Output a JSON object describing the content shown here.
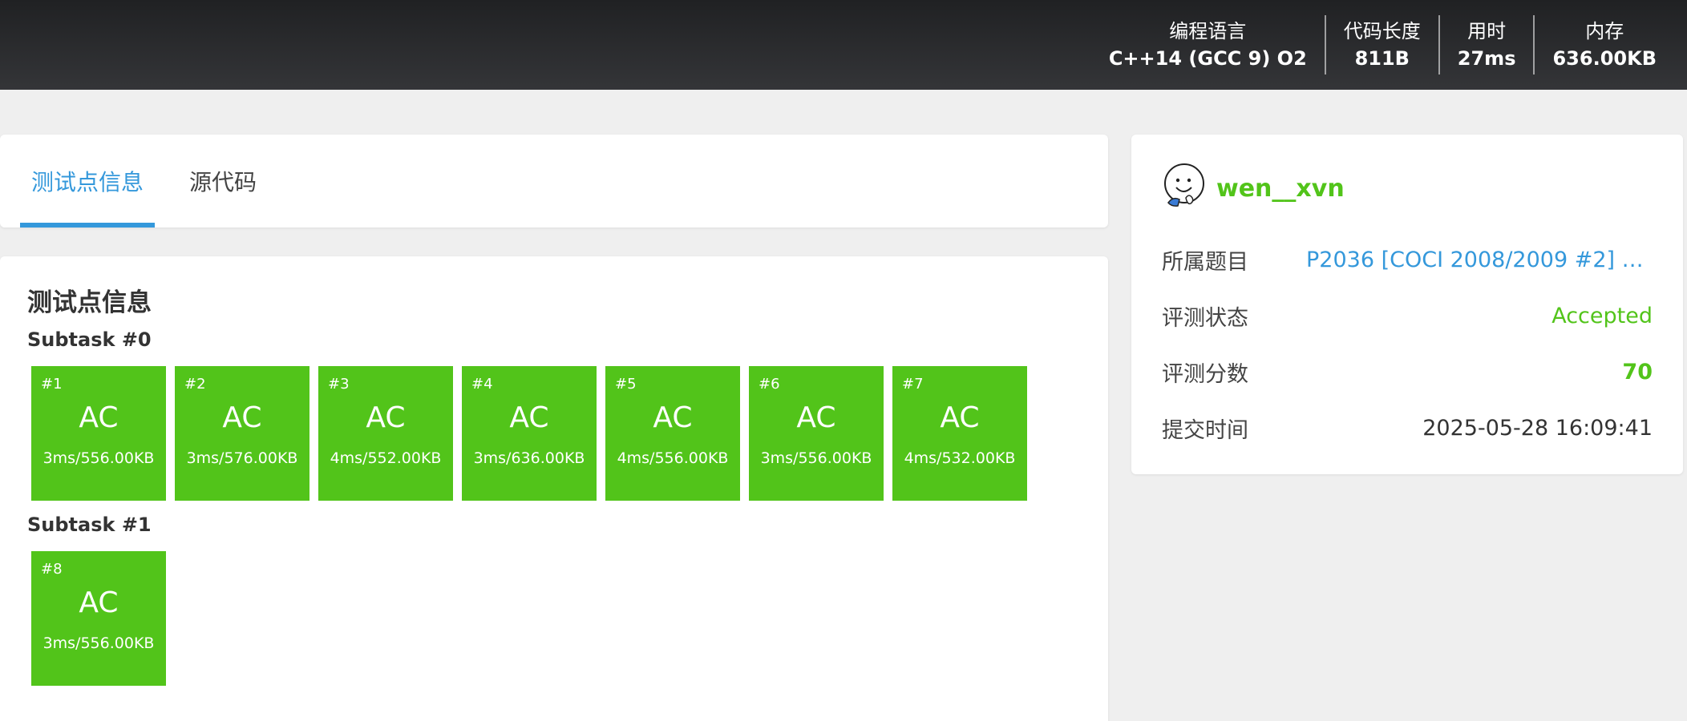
{
  "header": {
    "stats": [
      {
        "label": "编程语言",
        "value": "C++14 (GCC 9) O2"
      },
      {
        "label": "代码长度",
        "value": "811B"
      },
      {
        "label": "用时",
        "value": "27ms"
      },
      {
        "label": "内存",
        "value": "636.00KB"
      }
    ]
  },
  "tabs": {
    "testcase": "测试点信息",
    "source": "源代码"
  },
  "tests": {
    "title": "测试点信息",
    "subtasks": [
      {
        "title": "Subtask #0",
        "cases": [
          {
            "id": "#1",
            "status": "AC",
            "usage": "3ms/556.00KB"
          },
          {
            "id": "#2",
            "status": "AC",
            "usage": "3ms/576.00KB"
          },
          {
            "id": "#3",
            "status": "AC",
            "usage": "4ms/552.00KB"
          },
          {
            "id": "#4",
            "status": "AC",
            "usage": "3ms/636.00KB"
          },
          {
            "id": "#5",
            "status": "AC",
            "usage": "4ms/556.00KB"
          },
          {
            "id": "#6",
            "status": "AC",
            "usage": "3ms/556.00KB"
          },
          {
            "id": "#7",
            "status": "AC",
            "usage": "4ms/532.00KB"
          }
        ]
      },
      {
        "title": "Subtask #1",
        "cases": [
          {
            "id": "#8",
            "status": "AC",
            "usage": "3ms/556.00KB"
          }
        ]
      }
    ]
  },
  "info": {
    "username": "wen__xvn",
    "problem_label": "所属题目",
    "problem_value": "P2036 [COCI 2008/2009 #2] PE...",
    "status_label": "评测状态",
    "status_value": "Accepted",
    "score_label": "评测分数",
    "score_value": "70",
    "time_label": "提交时间",
    "time_value": "2025-05-28 16:09:41"
  },
  "colors": {
    "accent": "#3498db",
    "accepted": "#52c41a",
    "header_bg": "#2a2b2d"
  }
}
